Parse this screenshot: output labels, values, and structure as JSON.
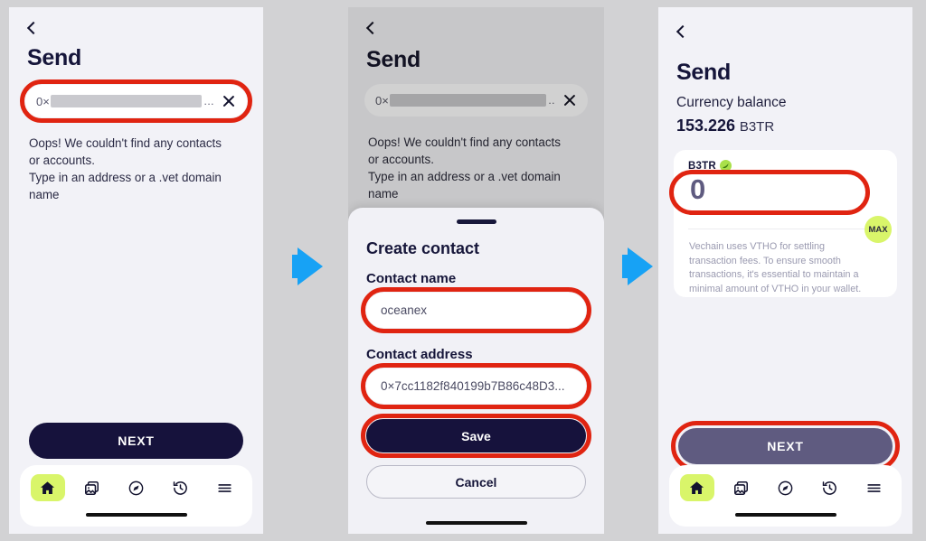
{
  "colors": {
    "background": "#d2d2d4",
    "screen_bg": "#f2f2f7",
    "highlight_ring": "#e02411",
    "arrow_blue": "#17a2f5",
    "primary_dark": "#16123c",
    "primary_muted": "#5f5b80",
    "accent_lime": "#d9f56a",
    "token_green": "#a9e04a",
    "text_dark": "#16163a",
    "text_muted": "#9a9ab0"
  },
  "flow": {
    "arrow_1_name": "step-arrow-1",
    "arrow_2_name": "step-arrow-2"
  },
  "panel1": {
    "back_label": "back",
    "title": "Send",
    "search": {
      "prefix": "0×",
      "value_redacted": true,
      "ellipsis": "...",
      "clear_label": "clear"
    },
    "empty_state": "Oops! We couldn't find any contacts or accounts.\nType in an address or a .vet domain name",
    "empty_state_line1": "Oops! We couldn't find any contacts",
    "empty_state_line2": "or accounts.",
    "empty_state_line3": "Type in an address or a .vet domain",
    "empty_state_line4": "name",
    "next_label": "NEXT"
  },
  "panel2": {
    "back_label": "back",
    "title": "Send",
    "search": {
      "prefix": "0×",
      "ellipsis": "..",
      "clear_label": "clear"
    },
    "empty_state_line1": "Oops! We couldn't find any contacts",
    "empty_state_line2": "or accounts.",
    "empty_state_line3": "Type in an address or a .vet domain",
    "empty_state_line4": "name",
    "sheet": {
      "title": "Create contact",
      "name_label": "Contact name",
      "name_value": "oceanex",
      "address_label": "Contact address",
      "address_value": "0×7cc1182f840199b7B86c48D3...",
      "save_label": "Save",
      "cancel_label": "Cancel"
    }
  },
  "panel3": {
    "back_label": "back",
    "title": "Send",
    "balance_label": "Currency balance",
    "balance_amount": "153.226",
    "balance_symbol": "B3TR",
    "token_name": "B3TR",
    "amount_value": "0",
    "max_label": "MAX",
    "note_line1": "Vechain uses VTHO for settling",
    "note_line2": "transaction fees. To ensure smooth",
    "note_line3": "transactions, it's essential to maintain a",
    "note_line4": "minimal amount of VTHO in your wallet.",
    "next_label": "NEXT"
  },
  "nav": {
    "items": [
      {
        "icon": "home-icon",
        "label": "Home",
        "active": true
      },
      {
        "icon": "gallery-icon",
        "label": "Collection",
        "active": false
      },
      {
        "icon": "compass-icon",
        "label": "Explore",
        "active": false
      },
      {
        "icon": "history-icon",
        "label": "Activity",
        "active": false
      },
      {
        "icon": "menu-icon",
        "label": "Menu",
        "active": false
      }
    ]
  }
}
